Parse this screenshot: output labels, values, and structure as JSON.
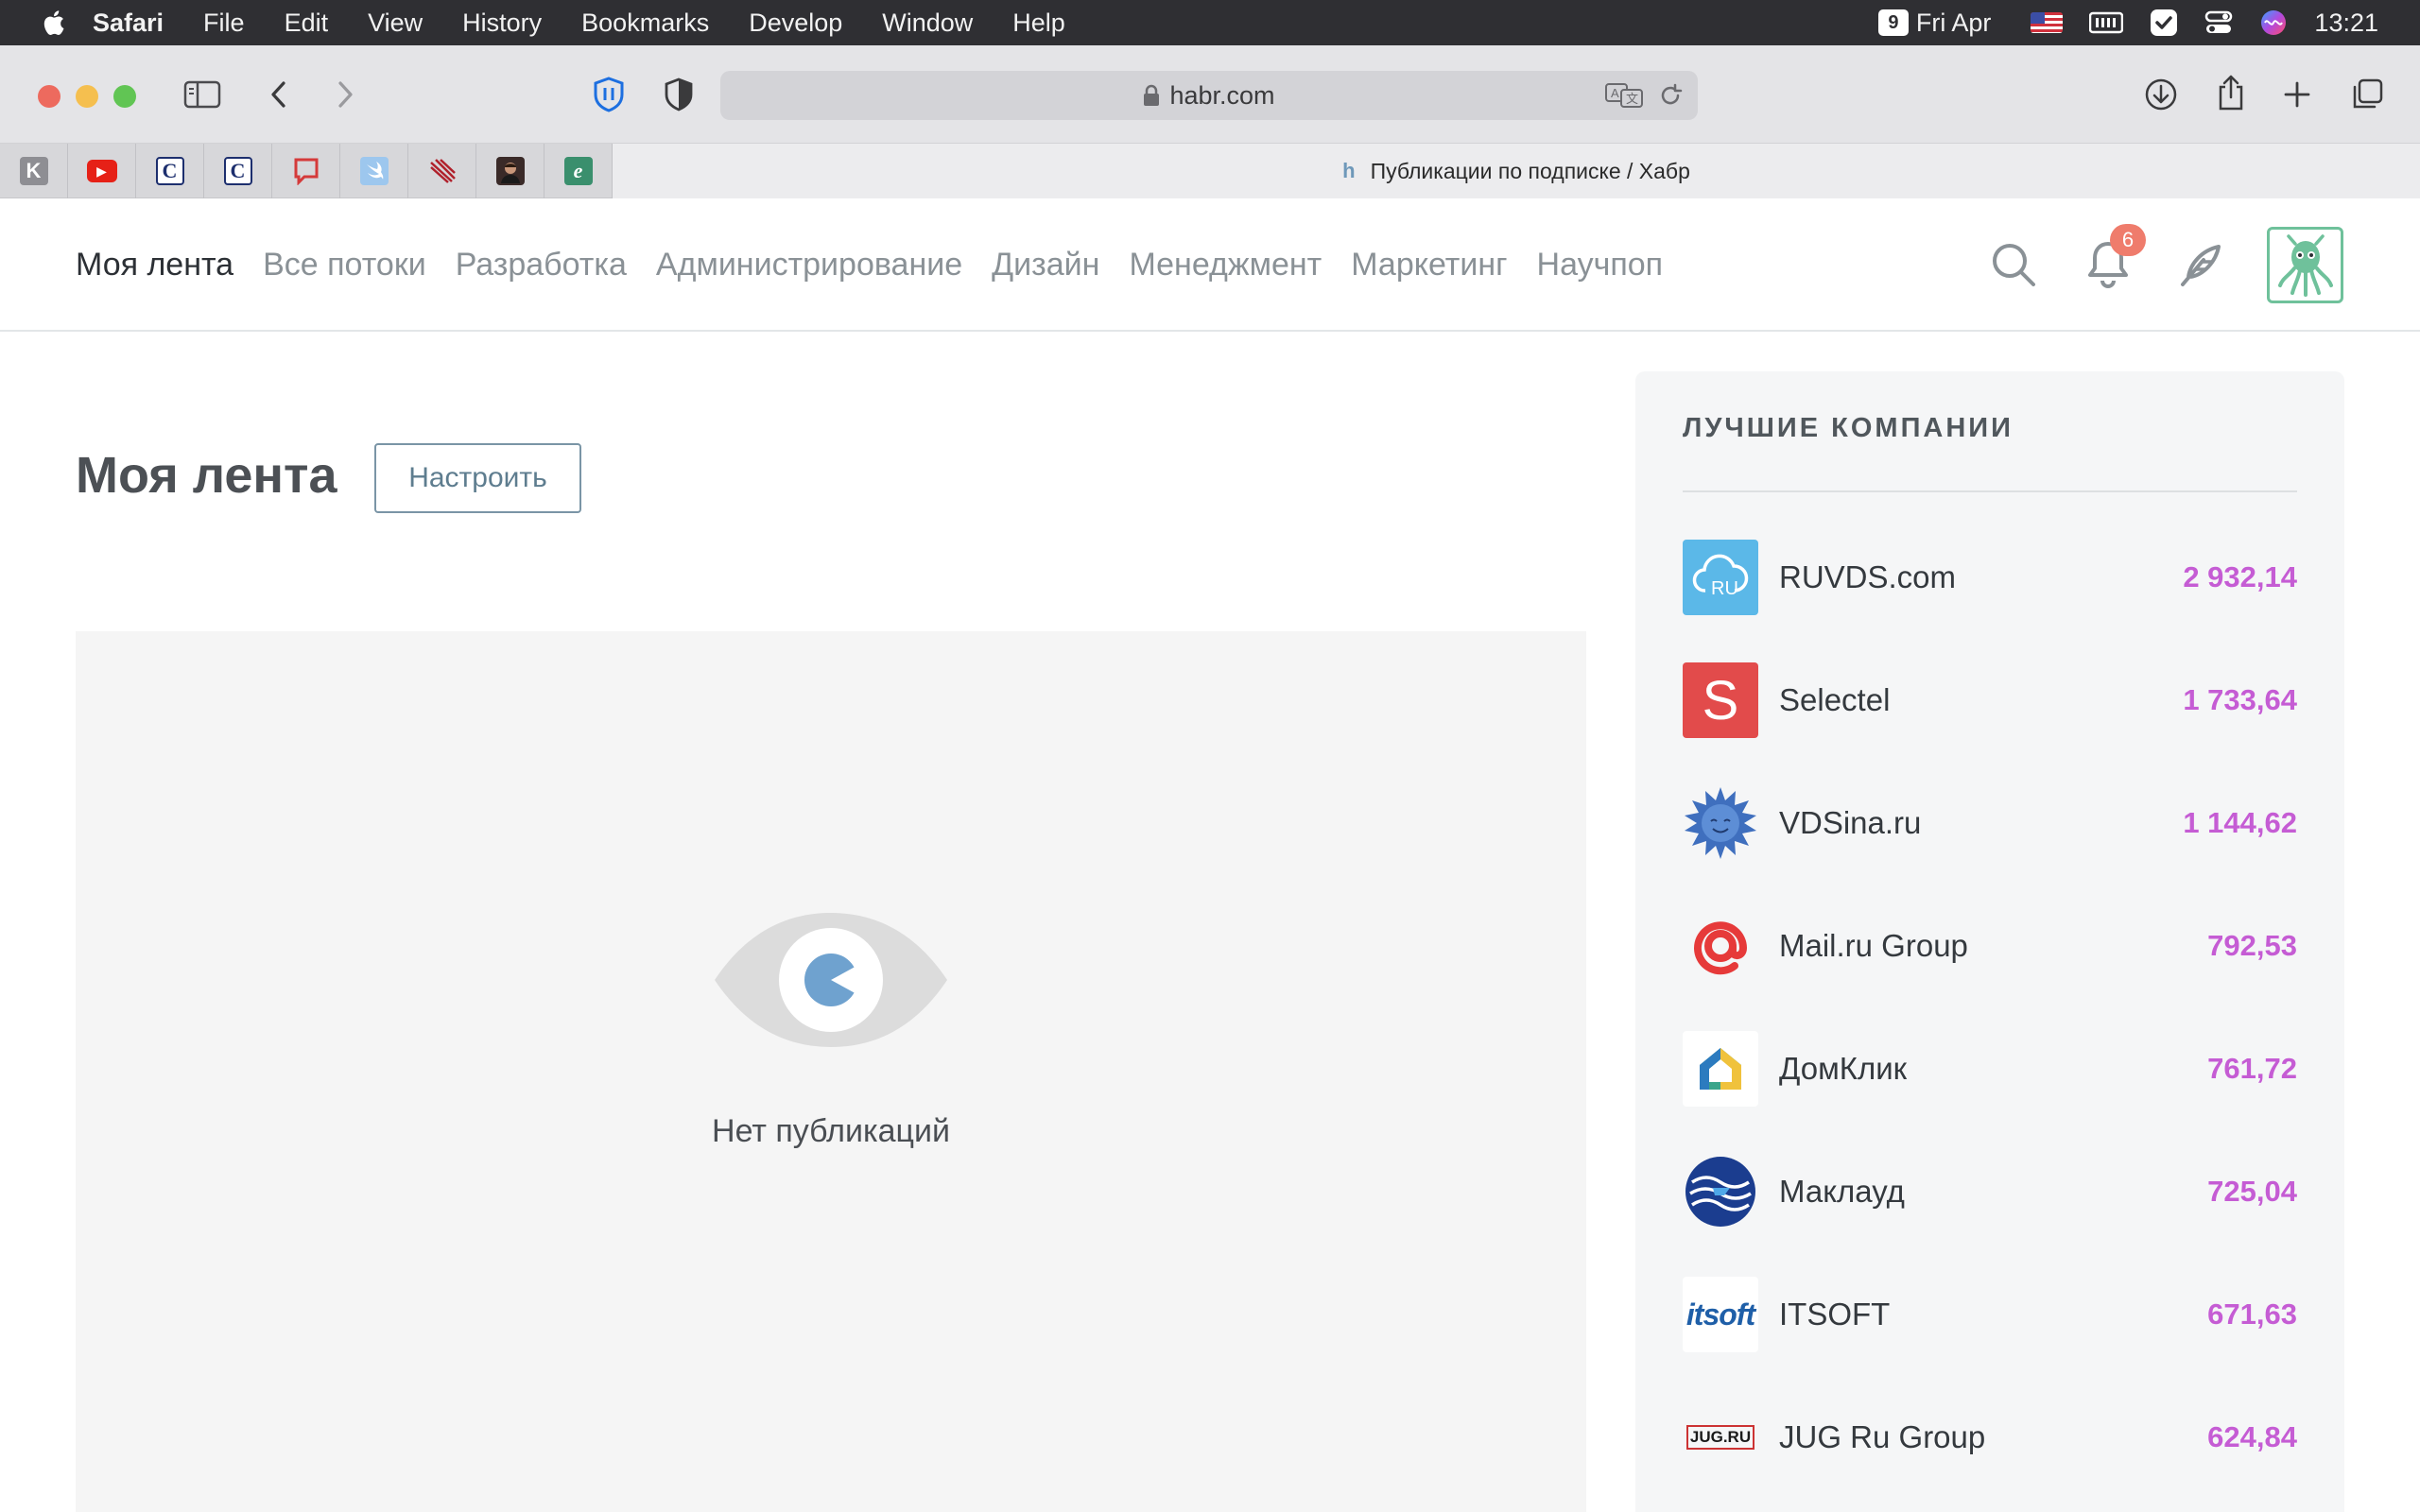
{
  "menubar": {
    "app_name": "Safari",
    "items": [
      "File",
      "Edit",
      "View",
      "History",
      "Bookmarks",
      "Develop",
      "Window",
      "Help"
    ],
    "calendar_day": "9",
    "date": "Fri Apr",
    "time": "13:21"
  },
  "toolbar": {
    "url": "habr.com"
  },
  "tabs": {
    "favorites": [
      {
        "icon": "k-icon",
        "letter": "K",
        "bg": "#8e8e93",
        "fg": "#ffffff"
      },
      {
        "icon": "youtube-icon",
        "letter": "▶",
        "bg": "#e62117",
        "fg": "#ffffff"
      },
      {
        "icon": "c-icon",
        "letter": "C",
        "bg": "#ffffff",
        "fg": "#1d2f6e"
      },
      {
        "icon": "c-icon",
        "letter": "C",
        "bg": "#ffffff",
        "fg": "#1d2f6e"
      },
      {
        "icon": "speech-bubble-icon",
        "letter": "",
        "bg": "transparent",
        "fg": "#d43a3a"
      },
      {
        "icon": "swift-icon",
        "letter": "",
        "bg": "#9dc7ee",
        "fg": "#ffffff"
      },
      {
        "icon": "stripes-icon",
        "letter": "",
        "bg": "transparent",
        "fg": "#b0202b"
      },
      {
        "icon": "portrait-icon",
        "letter": "",
        "bg": "#3a2a28",
        "fg": "#ffffff"
      },
      {
        "icon": "e-icon",
        "letter": "e",
        "bg": "#3a8f6d",
        "fg": "#ffffff"
      }
    ],
    "active_tab_prefix": "h",
    "active_tab_title": "Публикации по подписке / Хабр"
  },
  "nav": {
    "links": [
      {
        "label": "Моя лента",
        "active": true
      },
      {
        "label": "Все потоки",
        "active": false
      },
      {
        "label": "Разработка",
        "active": false
      },
      {
        "label": "Администрирование",
        "active": false
      },
      {
        "label": "Дизайн",
        "active": false
      },
      {
        "label": "Менеджмент",
        "active": false
      },
      {
        "label": "Маркетинг",
        "active": false
      },
      {
        "label": "Научпоп",
        "active": false
      }
    ],
    "notification_count": "6"
  },
  "main": {
    "title": "Моя лента",
    "configure_label": "Настроить",
    "empty_text": "Нет публикаций"
  },
  "sidebar": {
    "title": "ЛУЧШИЕ КОМПАНИИ",
    "companies": [
      {
        "name": "RUVDS.com",
        "score": "2 932,14",
        "logo": "ruvds-icon",
        "logo_bg": "#5bb8e8"
      },
      {
        "name": "Selectel",
        "score": "1 733,64",
        "logo": "selectel-icon",
        "logo_bg": "#e24b4b"
      },
      {
        "name": "VDSina.ru",
        "score": "1 144,62",
        "logo": "vdsina-icon",
        "logo_bg": "transparent"
      },
      {
        "name": "Mail.ru Group",
        "score": "792,53",
        "logo": "mailru-icon",
        "logo_bg": "transparent"
      },
      {
        "name": "ДомКлик",
        "score": "761,72",
        "logo": "domclick-icon",
        "logo_bg": "#ffffff"
      },
      {
        "name": "Маклауд",
        "score": "725,04",
        "logo": "macloud-icon",
        "logo_bg": "transparent"
      },
      {
        "name": "ITSOFT",
        "score": "671,63",
        "logo": "itsoft-icon",
        "logo_bg": "#ffffff"
      },
      {
        "name": "JUG Ru Group",
        "score": "624,84",
        "logo": "jugru-icon",
        "logo_bg": "transparent"
      }
    ],
    "logo_texts": {
      "ruvds": "RU",
      "selectel": "S",
      "itsoft": "itsoft",
      "jugru": "JUG.RU"
    }
  },
  "colors": {
    "score": "#c55cd4",
    "nav_active": "#2c3035",
    "nav_inactive": "#8a9196",
    "badge": "#ef7c6c",
    "accent_green": "#6fc19b"
  }
}
